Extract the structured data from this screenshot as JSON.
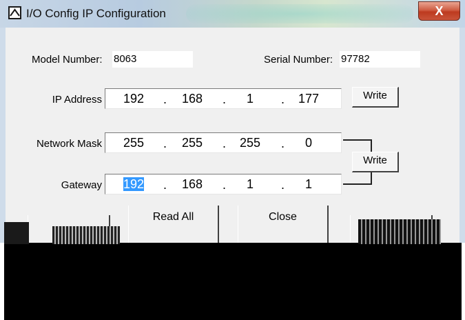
{
  "window": {
    "title": "I/O Config IP Configuration",
    "close_glyph": "X"
  },
  "model": {
    "label": "Model Number:",
    "value": "8063"
  },
  "serial": {
    "label": "Serial Number:",
    "value": "97782"
  },
  "ip_address": {
    "label": "IP Address",
    "octets": [
      "192",
      "168",
      "1",
      "177"
    ],
    "write_label": "Write"
  },
  "network_mask": {
    "label": "Network Mask",
    "octets": [
      "255",
      "255",
      "255",
      "0"
    ]
  },
  "gateway": {
    "label": "Gateway",
    "octets": [
      "192",
      "168",
      "1",
      "1"
    ]
  },
  "mask_gateway_write_label": "Write",
  "buttons": {
    "read_all": "Read All",
    "close": "Close"
  },
  "ip_separator": ".",
  "colors": {
    "selection": "#3399ff",
    "close_button": "#c9543a",
    "dialog_bg": "#f0f0f0"
  }
}
